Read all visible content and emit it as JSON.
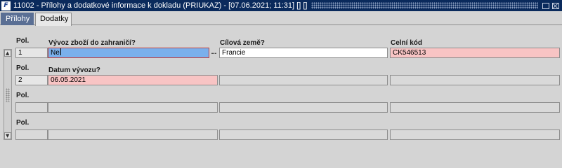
{
  "window": {
    "title": "11002 - Přílohy a dodatkové informace k dokladu (PRIUKAZ) - [07.06.2021; 11:31] [] []",
    "icon": "app-icon"
  },
  "tabs": [
    {
      "label": "Přílohy",
      "active": false
    },
    {
      "label": "Dodatky",
      "active": true
    }
  ],
  "records": [
    {
      "pol_label": "Pol.",
      "pol_value": "1",
      "field1_label": "Vývoz zboží do zahraničí?",
      "field1_value": "Ne",
      "field2_label": "Cílová země?",
      "field2_value": "Francie",
      "field3_label": "Celní kód",
      "field3_value": "CK546513"
    },
    {
      "pol_label": "Pol.",
      "pol_value": "2",
      "field1_label": "Datum vývozu?",
      "field1_value": "06.05.2021"
    },
    {
      "pol_label": "Pol."
    },
    {
      "pol_label": "Pol."
    }
  ],
  "lov_button_label": "...",
  "colors": {
    "titlebar": "#0a2a5c",
    "current_field": "#7ab0ec",
    "required_field": "#f8c4c4",
    "tab_inactive": "#5a6f94"
  }
}
